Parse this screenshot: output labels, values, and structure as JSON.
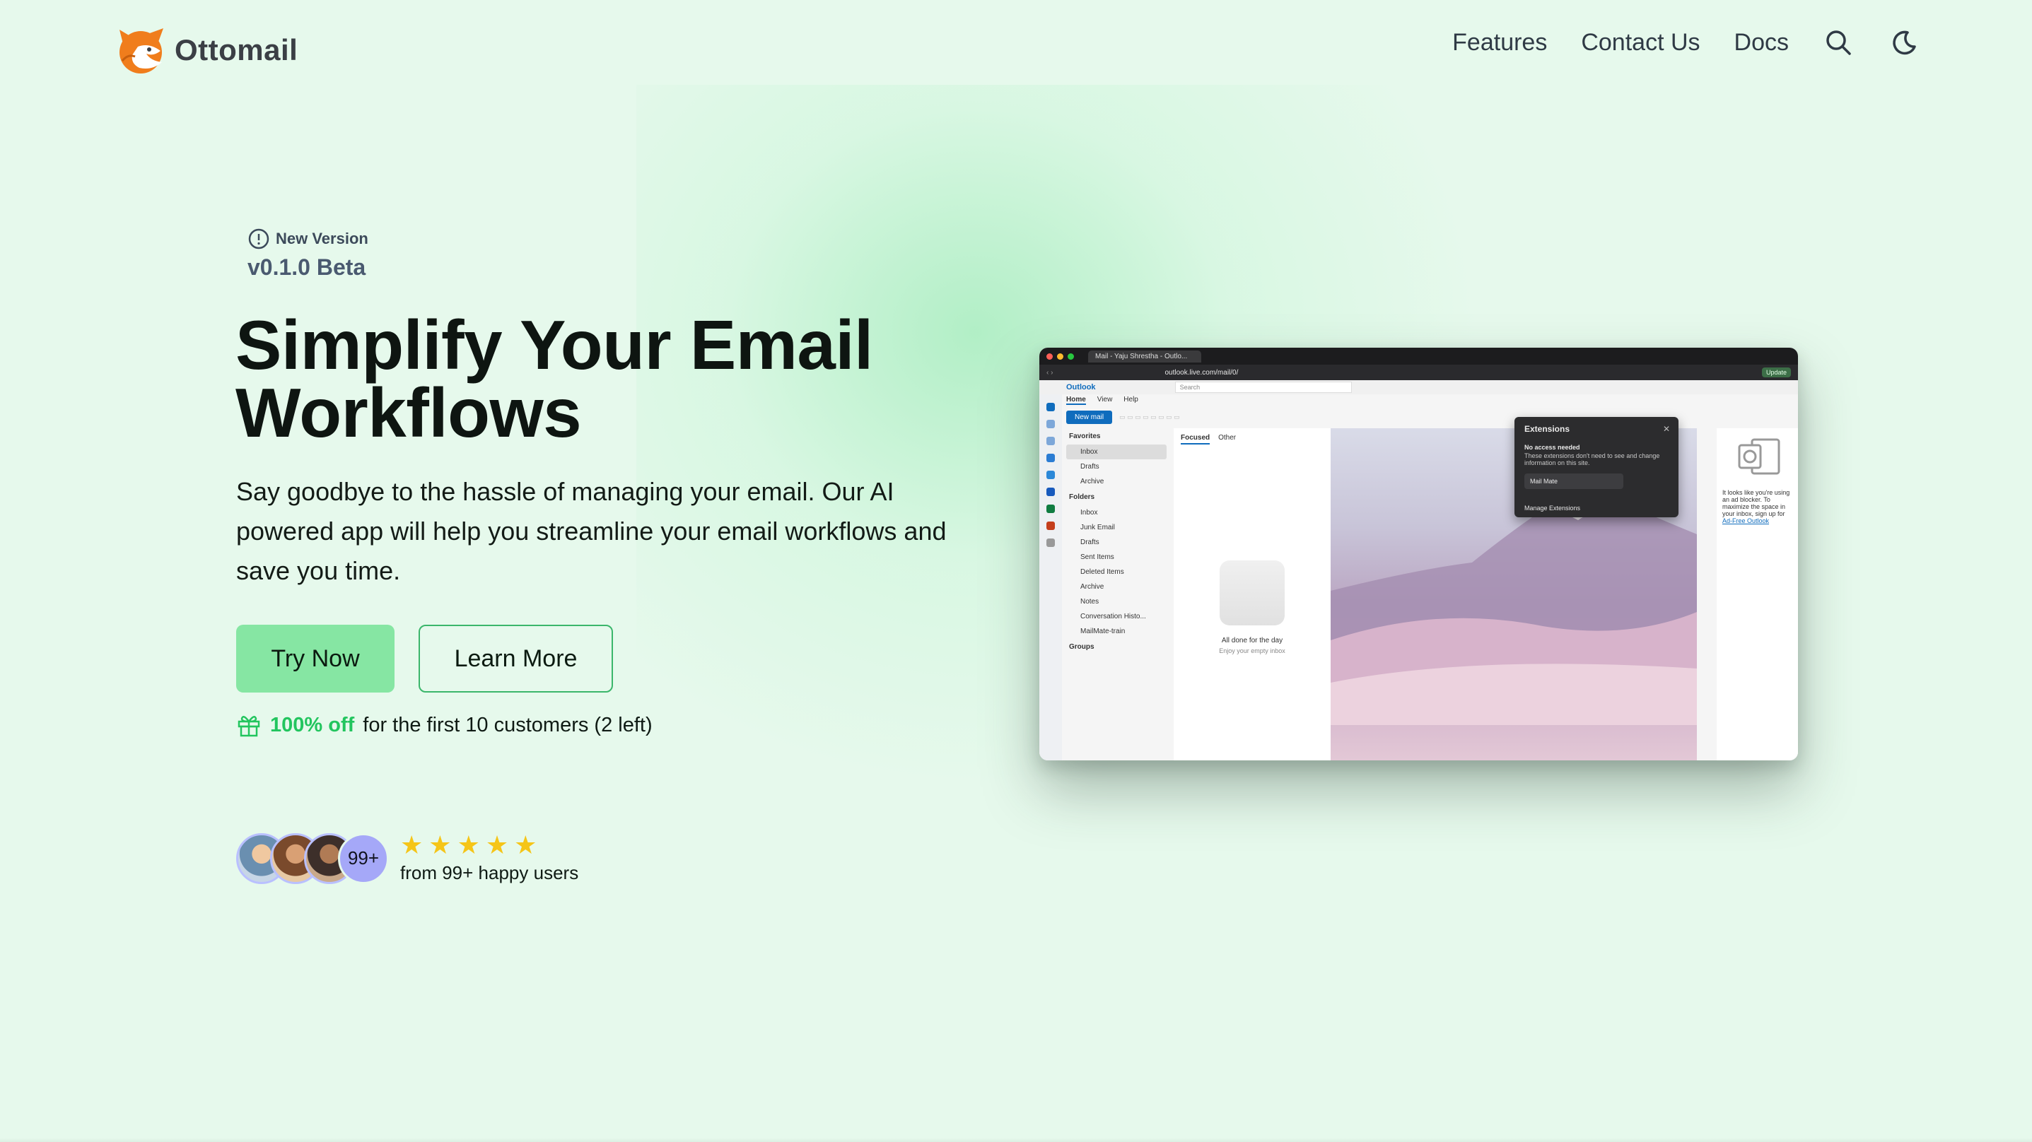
{
  "brand": {
    "name": "Ottomail",
    "accent": "#22c55e",
    "primary_button_color": "#86e6a3",
    "background": "#e6f9ec"
  },
  "nav": {
    "items": [
      "Features",
      "Contact Us",
      "Docs"
    ],
    "icons": [
      "search-icon",
      "moon-icon"
    ]
  },
  "hero": {
    "badge_label": "New Version",
    "version": "v0.1.0 Beta",
    "title_line1": "Simplify Your Email",
    "title_line2": "Workflows",
    "subtitle": "Say goodbye to the hassle of managing your email. Our AI powered app will help you streamline your email workflows and save you time.",
    "primary_cta": "Try Now",
    "secondary_cta": "Learn More",
    "promo_strong": "100% off",
    "promo_rest": "for the first 10 customers (2 left)"
  },
  "social_proof": {
    "avatar_count_label": "99+",
    "stars": 5,
    "text": "from 99+ happy users"
  },
  "preview": {
    "tab_title": "Mail - Yaju Shrestha - Outlo...",
    "url": "outlook.live.com/mail/0/",
    "update_label": "Update",
    "app_name": "Outlook",
    "search_placeholder": "Search",
    "ribbon_tabs": [
      "Home",
      "View",
      "Help"
    ],
    "new_mail": "New mail",
    "favorites_label": "Favorites",
    "favorites": [
      "Inbox",
      "Drafts",
      "Archive"
    ],
    "folders_label": "Folders",
    "folders": [
      "Inbox",
      "Junk Email",
      "Drafts",
      "Sent Items",
      "Deleted Items",
      "Archive",
      "Notes",
      "Conversation Histo...",
      "MailMate-train"
    ],
    "groups_label": "Groups",
    "list_tabs": [
      "Focused",
      "Other"
    ],
    "empty_title": "All done for the day",
    "empty_sub": "Enjoy your empty inbox",
    "ad_text": "It looks like you're using an ad blocker. To maximize the space in your inbox, sign up for",
    "ad_link": "Ad-Free Outlook",
    "ext_title": "Extensions",
    "ext_subhead": "No access needed",
    "ext_desc": "These extensions don't need to see and change information on this site.",
    "ext_item": "Mail Mate",
    "ext_manage": "Manage Extensions"
  }
}
